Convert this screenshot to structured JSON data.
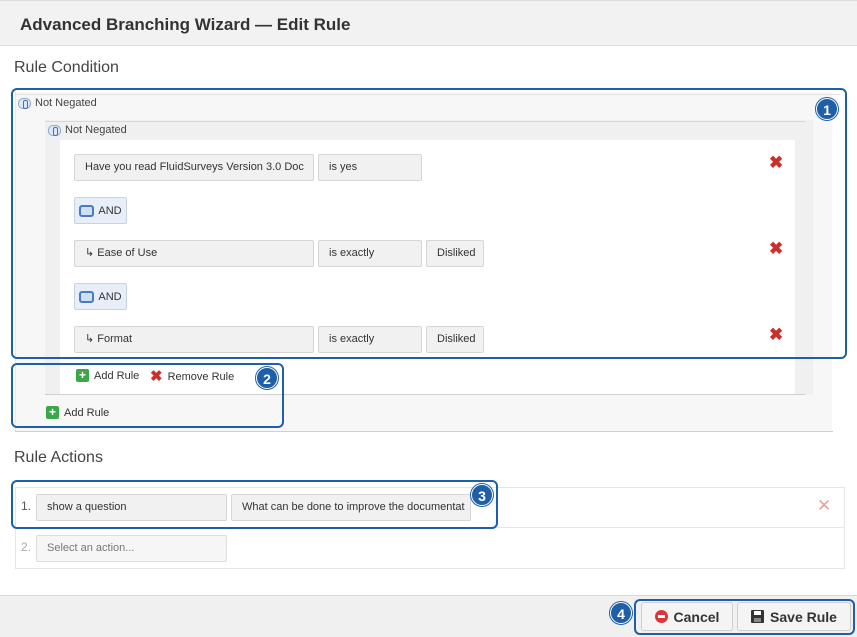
{
  "window": {
    "title": "Advanced Branching Wizard — Edit Rule"
  },
  "rule_condition": {
    "section_title": "Rule Condition",
    "outer_group": {
      "negation_label": "Not Negated",
      "add_rule_label": "Add Rule"
    },
    "inner_group": {
      "negation_label": "Not Negated",
      "conditions": [
        {
          "question": "Have you read FluidSurveys Version 3.0 Doc",
          "operator": "is yes",
          "value": ""
        },
        {
          "question": "↳ Ease of Use",
          "operator": "is exactly",
          "value": "Disliked"
        },
        {
          "question": "↳ Format",
          "operator": "is exactly",
          "value": "Disliked"
        }
      ],
      "connectors": [
        "AND",
        "AND"
      ],
      "add_rule_label": "Add Rule",
      "remove_rule_label": "Remove Rule"
    }
  },
  "rule_actions": {
    "section_title": "Rule Actions",
    "rows": [
      {
        "number": "1.",
        "action": "show a question",
        "target": "What can be done to improve the documentat"
      },
      {
        "number": "2.",
        "placeholder": "Select an action..."
      }
    ]
  },
  "footer": {
    "cancel_label": "Cancel",
    "save_label": "Save Rule"
  },
  "callouts": [
    "1",
    "2",
    "3",
    "4"
  ],
  "icons": {
    "negation": "toggle-negation-icon",
    "connector": "swap-connector-icon",
    "delete": "delete-x-icon",
    "add": "green-plus-icon",
    "cancel": "cancel-icon",
    "save": "floppy-disk-icon"
  },
  "colors": {
    "callout": "#1f5fa8",
    "delete": "#c9302c",
    "add": "#3ca64a"
  }
}
